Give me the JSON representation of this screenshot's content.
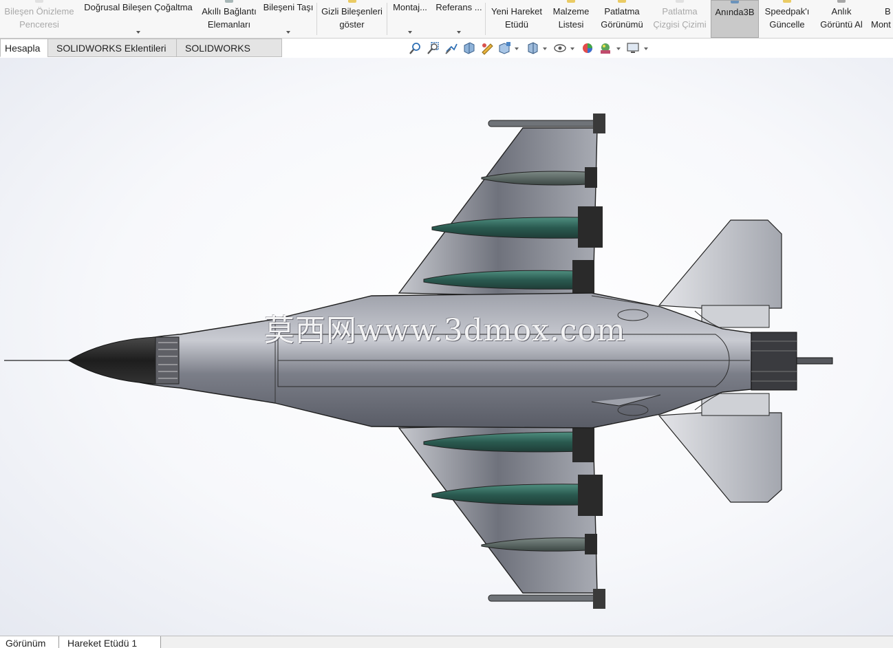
{
  "ribbon": {
    "buttons": [
      {
        "id": "preview",
        "line1": "Bileşen Önizleme",
        "line2": "Penceresi",
        "disabled": true
      },
      {
        "id": "linear",
        "line1": "Doğrusal Bileşen Çoğaltma",
        "line2": ""
      },
      {
        "id": "smart",
        "line1": "Akıllı Bağlantı",
        "line2": "Elemanları"
      },
      {
        "id": "move",
        "line1": "Bileşeni Taşı",
        "line2": ""
      },
      {
        "id": "hidden",
        "line1": "Gizli Bileşenleri",
        "line2": "göster"
      },
      {
        "id": "assembly",
        "line1": "Montaj...",
        "line2": ""
      },
      {
        "id": "reference",
        "line1": "Referans ...",
        "line2": ""
      },
      {
        "id": "motion",
        "line1": "Yeni Hareket",
        "line2": "Etüdü"
      },
      {
        "id": "bom",
        "line1": "Malzeme",
        "line2": "Listesi"
      },
      {
        "id": "explode",
        "line1": "Patlatma",
        "line2": "Görünümü"
      },
      {
        "id": "explodeline",
        "line1": "Patlatma",
        "line2": "Çizgisi Çizimi",
        "disabled": true
      },
      {
        "id": "instant3d",
        "line1": "Anında3B",
        "line2": "",
        "active": true
      },
      {
        "id": "speedpak",
        "line1": "Speedpak'ı",
        "line2": "Güncelle"
      },
      {
        "id": "snapshot",
        "line1": "Anlık",
        "line2": "Görüntü Al"
      },
      {
        "id": "more",
        "line1": "B",
        "line2": "Mont"
      }
    ]
  },
  "tabs": [
    "Hesapla",
    "SOLIDWORKS Eklentileri",
    "SOLIDWORKS MBD"
  ],
  "hud_icons": [
    "zoom-to-fit-icon",
    "zoom-area-icon",
    "previous-view-icon",
    "section-view-icon",
    "dynamic-annotation-icon",
    "view-orientation-icon",
    "display-style-icon",
    "hide-show-items-icon",
    "edit-appearance-icon",
    "apply-scene-icon",
    "view-settings-icon"
  ],
  "watermark": "莫西网www.3dmox.com",
  "bottom_tabs": [
    "Görünüm",
    "Hareket Etüdü 1"
  ],
  "colors": {
    "accent": "#c9c9c9",
    "missile": "#2e6b5e",
    "body": "#7c7f89"
  }
}
